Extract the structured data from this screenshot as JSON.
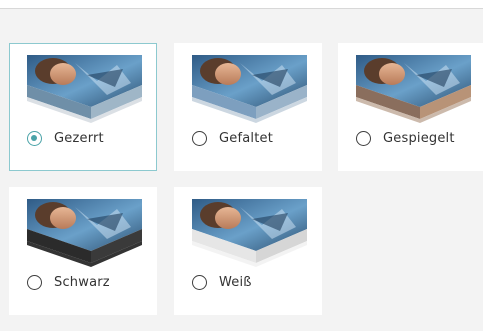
{
  "accent_color": "#4aa3a8",
  "options": [
    {
      "label": "Gezerrt",
      "selected": true,
      "edge": "stretched"
    },
    {
      "label": "Gefaltet",
      "selected": false,
      "edge": "folded"
    },
    {
      "label": "Gespiegelt",
      "selected": false,
      "edge": "mirrored"
    },
    {
      "label": "Schwarz",
      "selected": false,
      "edge": "black"
    },
    {
      "label": "Weiß",
      "selected": false,
      "edge": "white"
    }
  ]
}
